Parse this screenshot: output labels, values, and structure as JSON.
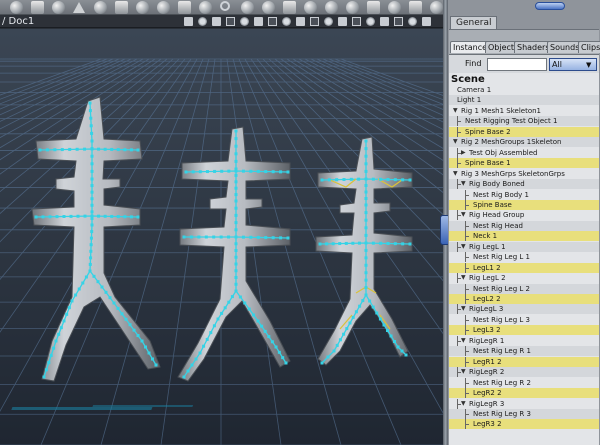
{
  "document": {
    "title": "/ Doc1"
  },
  "toolbar": {
    "icons": [
      "sphere-icon",
      "goblet-icon",
      "figure-icon",
      "cube-icon",
      "rotate-icon",
      "move-icon",
      "text-icon",
      "cone-icon",
      "cylinder-icon",
      "torus-icon",
      "gear-icon",
      "plane-icon",
      "sphere-small-icon",
      "vase-icon",
      "dish-icon",
      "wand-icon",
      "lamp-icon",
      "nodes-icon",
      "grid-icon",
      "box-icon",
      "cube-shaded-icon"
    ]
  },
  "panel": {
    "general_tab": "General",
    "tabs": [
      "Instances",
      "Objects",
      "Shaders",
      "Sounds",
      "Clips"
    ],
    "active_tab": "Instances",
    "find_label": "Find",
    "find_value": "",
    "find_filter": "All",
    "scene_heading": "Scene",
    "tree": [
      {
        "label": "Camera 1",
        "depth": 0,
        "toggle": "",
        "hl": false
      },
      {
        "label": "Light 1",
        "depth": 0,
        "toggle": "",
        "hl": false
      },
      {
        "label": "Rig 1 Mesh1 Skeleton1",
        "depth": 0,
        "toggle": "▼",
        "hl": false
      },
      {
        "label": "Nest Rigging Test Object 1",
        "depth": 1,
        "toggle": "",
        "hl": false
      },
      {
        "label": "Spine Base 2",
        "depth": 1,
        "toggle": "",
        "hl": true
      },
      {
        "label": "Rig 2 MeshGroups 1Skeleton",
        "depth": 0,
        "toggle": "▼",
        "hl": false
      },
      {
        "label": "Test Obj Assembled",
        "depth": 1,
        "toggle": "▶",
        "hl": false
      },
      {
        "label": "Spine Base 1",
        "depth": 1,
        "toggle": "",
        "hl": true
      },
      {
        "label": "Rig 3 MeshGrps SkeletonGrps",
        "depth": 0,
        "toggle": "▼",
        "hl": false
      },
      {
        "label": "Rig Body Boned",
        "depth": 1,
        "toggle": "▼",
        "hl": false
      },
      {
        "label": "Nest Rig Body 1",
        "depth": 2,
        "toggle": "",
        "hl": false
      },
      {
        "label": "Spine Base",
        "depth": 2,
        "toggle": "",
        "hl": true
      },
      {
        "label": "Rig Head Group",
        "depth": 1,
        "toggle": "▼",
        "hl": false
      },
      {
        "label": "Nest Rig Head",
        "depth": 2,
        "toggle": "",
        "hl": false
      },
      {
        "label": "Neck 1",
        "depth": 2,
        "toggle": "",
        "hl": true
      },
      {
        "label": "Rig LegL 1",
        "depth": 1,
        "toggle": "▼",
        "hl": false
      },
      {
        "label": "Nest Rig Leg L 1",
        "depth": 2,
        "toggle": "",
        "hl": false
      },
      {
        "label": "LegL1 2",
        "depth": 2,
        "toggle": "",
        "hl": true
      },
      {
        "label": "Rig LegL 2",
        "depth": 1,
        "toggle": "▼",
        "hl": false
      },
      {
        "label": "Nest Rig Leg L 2",
        "depth": 2,
        "toggle": "",
        "hl": false
      },
      {
        "label": "LegL2 2",
        "depth": 2,
        "toggle": "",
        "hl": true
      },
      {
        "label": "RigLegL 3",
        "depth": 1,
        "toggle": "▼",
        "hl": false
      },
      {
        "label": "Nest Rig Leg L 3",
        "depth": 2,
        "toggle": "",
        "hl": false
      },
      {
        "label": "LegL3 2",
        "depth": 2,
        "toggle": "",
        "hl": true
      },
      {
        "label": "RigLegR 1",
        "depth": 1,
        "toggle": "▼",
        "hl": false
      },
      {
        "label": "Nest Rig Leg R 1",
        "depth": 2,
        "toggle": "",
        "hl": false
      },
      {
        "label": "LegR1 2",
        "depth": 2,
        "toggle": "",
        "hl": true
      },
      {
        "label": "RigLegR 2",
        "depth": 1,
        "toggle": "▼",
        "hl": false
      },
      {
        "label": "Nest Rig Leg R 2",
        "depth": 2,
        "toggle": "",
        "hl": false
      },
      {
        "label": "LegR2 2",
        "depth": 2,
        "toggle": "",
        "hl": true
      },
      {
        "label": "RigLegR 3",
        "depth": 1,
        "toggle": "▼",
        "hl": false
      },
      {
        "label": "Nest Rig Leg R 3",
        "depth": 2,
        "toggle": "",
        "hl": false
      },
      {
        "label": "LegR3 2",
        "depth": 2,
        "toggle": "",
        "hl": true
      }
    ]
  },
  "colors": {
    "highlight_row": "#e8df7c",
    "skeleton_cyan": "#35d3e6",
    "skeleton_yellow": "#d9c23a",
    "mesh_gray": "#bfc3c8",
    "grid_blue": "#5f7ea3"
  }
}
